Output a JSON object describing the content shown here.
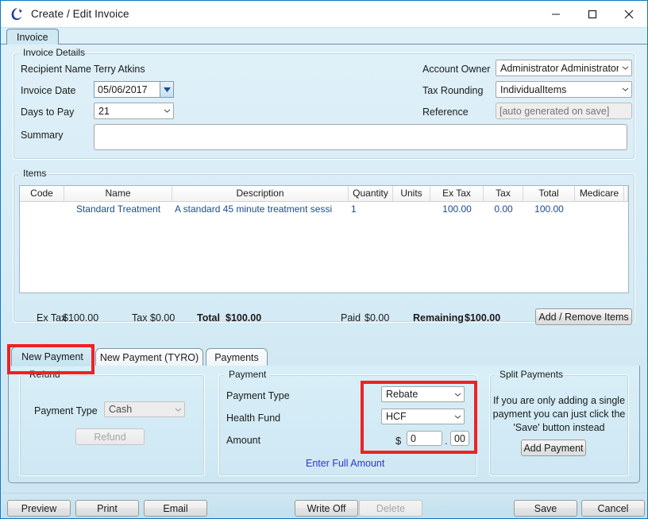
{
  "window": {
    "title": "Create / Edit Invoice",
    "icon": "app-swoosh-icon",
    "minimize_label": "–",
    "maximize_label": "□",
    "close_label": "✕"
  },
  "tabs": {
    "main": [
      {
        "label": "Invoice",
        "active": true
      }
    ]
  },
  "invoice_details": {
    "group_title": "Invoice Details",
    "recipient_name_label": "Recipient Name",
    "recipient_name_value": "Terry Atkins",
    "invoice_date_label": "Invoice Date",
    "invoice_date_value": "05/06/2017",
    "days_to_pay_label": "Days to Pay",
    "days_to_pay_value": "21",
    "summary_label": "Summary",
    "summary_value": "",
    "account_owner_label": "Account Owner",
    "account_owner_value": "Administrator Administrator",
    "tax_rounding_label": "Tax Rounding",
    "tax_rounding_value": "IndividualItems",
    "reference_label": "Reference",
    "reference_placeholder": "[auto generated on save]",
    "reference_value": ""
  },
  "items": {
    "group_title": "Items",
    "columns": [
      "Code",
      "Name",
      "Description",
      "Quantity",
      "Units",
      "Ex Tax",
      "Tax",
      "Total",
      "Medicare"
    ],
    "rows": [
      {
        "code": "",
        "name": "Standard Treatment",
        "description": "A standard 45 minute treatment sessi",
        "quantity": "1",
        "units": "",
        "ex_tax": "100.00",
        "tax": "0.00",
        "total": "100.00",
        "medicare": ""
      }
    ],
    "totals": {
      "ex_tax_label": "Ex Tax",
      "ex_tax_value": "$100.00",
      "tax_label": "Tax",
      "tax_value": "$0.00",
      "total_label": "Total",
      "total_value": "$100.00",
      "paid_label": "Paid",
      "paid_value": "$0.00",
      "remaining_label": "Remaining",
      "remaining_value": "$100.00"
    },
    "add_remove_button": "Add / Remove Items"
  },
  "payment_tabs": [
    {
      "label": "New Payment",
      "active": true
    },
    {
      "label": "New Payment (TYRO)",
      "active": false
    },
    {
      "label": "Payments",
      "active": false
    }
  ],
  "refund": {
    "group_title": "Refund",
    "payment_type_label": "Payment Type",
    "payment_type_value": "Cash",
    "refund_button": "Refund"
  },
  "payment": {
    "group_title": "Payment",
    "payment_type_label": "Payment Type",
    "payment_type_value": "Rebate",
    "health_fund_label": "Health Fund",
    "health_fund_value": "HCF",
    "amount_label": "Amount",
    "currency_symbol": "$",
    "amount_dollars": "0",
    "amount_decimal_separator": ".",
    "amount_cents": "00",
    "enter_full_amount_link": "Enter Full Amount"
  },
  "split_payments": {
    "group_title": "Split Payments",
    "help_line_1": "If you are only adding a single",
    "help_line_2": "payment you can just click the",
    "help_line_3": "'Save' button instead",
    "add_payment_button": "Add Payment"
  },
  "footer": {
    "preview": "Preview",
    "print": "Print",
    "email": "Email",
    "write_off": "Write Off",
    "delete": "Delete",
    "save": "Save",
    "cancel": "Cancel"
  },
  "annotations": {
    "highlight_color": "#ee2222",
    "boxes": [
      "new-payment-tab",
      "payment-fields"
    ]
  }
}
